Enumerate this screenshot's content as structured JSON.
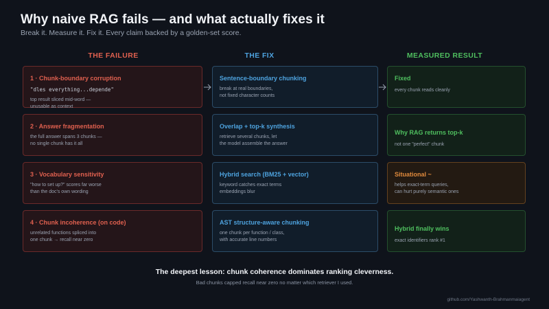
{
  "header": {
    "title": "Why naive RAG fails — and what actually fixes it",
    "subtitle": "Break it. Measure it. Fix it. Every claim backed by a golden-set score."
  },
  "columns": {
    "failure": "THE FAILURE",
    "fix": "THE FIX",
    "result": "MEASURED RESULT"
  },
  "rows": [
    {
      "failure": {
        "title": "1 · Chunk-boundary corruption",
        "code": "\"dles everything...depende\"",
        "body": "top result sliced mid-word —\nunusable as context"
      },
      "fix": {
        "title": "Sentence-boundary chunking",
        "body": "break at real boundaries,\nnot fixed character counts"
      },
      "result": {
        "title": "Fixed",
        "body": "every chunk reads cleanly",
        "status": "good"
      }
    },
    {
      "failure": {
        "title": "2 · Answer fragmentation",
        "code": "",
        "body": "the full answer spans 3 chunks —\nno single chunk has it all"
      },
      "fix": {
        "title": "Overlap + top-k synthesis",
        "body": "retrieve several chunks, let\nthe model assemble the answer"
      },
      "result": {
        "title": "Why RAG returns top-k",
        "body": "not one \"perfect\" chunk",
        "status": "good"
      }
    },
    {
      "failure": {
        "title": "3 · Vocabulary sensitivity",
        "code": "",
        "body": "\"how to set up?\" scores far worse\nthan the doc's own wording"
      },
      "fix": {
        "title": "Hybrid search (BM25 + vector)",
        "body": "keyword catches exact terms\nembeddings blur"
      },
      "result": {
        "title": "Situational ~",
        "body": "helps exact-term queries,\ncan hurt purely semantic ones",
        "status": "warn"
      }
    },
    {
      "failure": {
        "title": "4 · Chunk incoherence (on code)",
        "code": "",
        "body": "unrelated functions spliced into\none chunk → recall near zero"
      },
      "fix": {
        "title": "AST structure-aware chunking",
        "body": "one chunk per function / class,\nwith accurate line numbers"
      },
      "result": {
        "title": "Hybrid finally wins",
        "body": "exact identifiers rank #1",
        "status": "good"
      }
    }
  ],
  "footer": {
    "lesson": "The deepest lesson: chunk coherence dominates ranking cleverness.",
    "lesson_sub": "Bad chunks capped recall near zero no matter which retriever I used.",
    "credit": "github.com/Yashwanth-Brahmanmaiagent"
  },
  "colors": {
    "failure": "#e0604f",
    "fix": "#4ea3df",
    "result_good": "#4fbf5f",
    "result_warn": "#e08a3c",
    "background": "#0f131b"
  },
  "icons": {
    "connector": "right-arrow-icon"
  }
}
